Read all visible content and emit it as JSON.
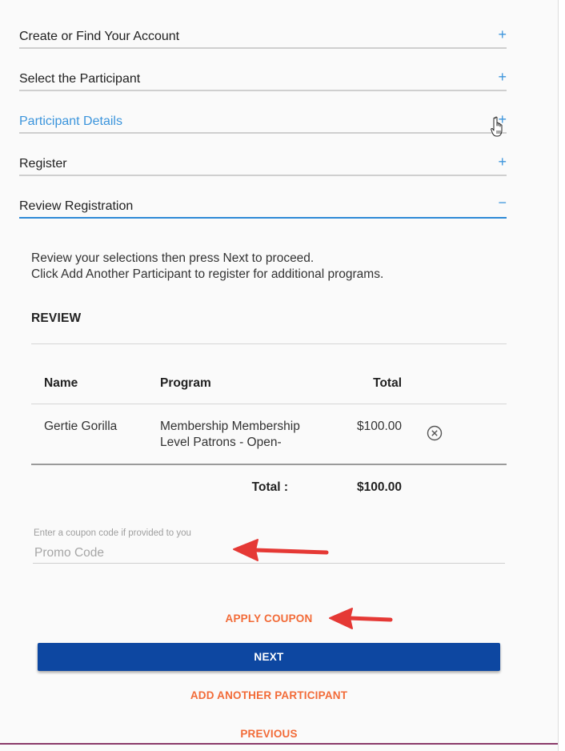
{
  "accordion": [
    {
      "label": "Create or Find Your Account",
      "toggle": "+"
    },
    {
      "label": "Select the Participant",
      "toggle": "+"
    },
    {
      "label": "Participant Details",
      "toggle": "+"
    },
    {
      "label": "Register",
      "toggle": "+"
    },
    {
      "label": "Review Registration",
      "toggle": "−"
    }
  ],
  "review": {
    "intro_line1": "Review your selections then press Next to proceed.",
    "intro_line2": "Click Add Another Participant to register for additional programs.",
    "title": "REVIEW",
    "columns": {
      "name": "Name",
      "program": "Program",
      "total": "Total"
    },
    "rows": [
      {
        "name": "Gertie Gorilla",
        "program_line1": "Membership Membership",
        "program_line2": "Level Patrons - Open-",
        "total": "$100.00"
      }
    ],
    "total_label": "Total :",
    "total_value": "$100.00"
  },
  "promo": {
    "help_text": "Enter a coupon code if provided to you",
    "placeholder": "Promo Code",
    "value": ""
  },
  "buttons": {
    "apply_coupon": "APPLY COUPON",
    "next": "NEXT",
    "add_participant": "ADD ANOTHER PARTICIPANT",
    "previous": "PREVIOUS"
  },
  "colors": {
    "accent_blue": "#3c95dc",
    "primary_button": "#0d47a1",
    "action_orange": "#f26b38",
    "annotation_red": "#e53935"
  },
  "icons": {
    "expand": "plus-icon",
    "collapse": "minus-icon",
    "remove": "remove-circle-icon",
    "pointer": "hand-cursor-icon",
    "annotation": "red-arrow-icon"
  }
}
